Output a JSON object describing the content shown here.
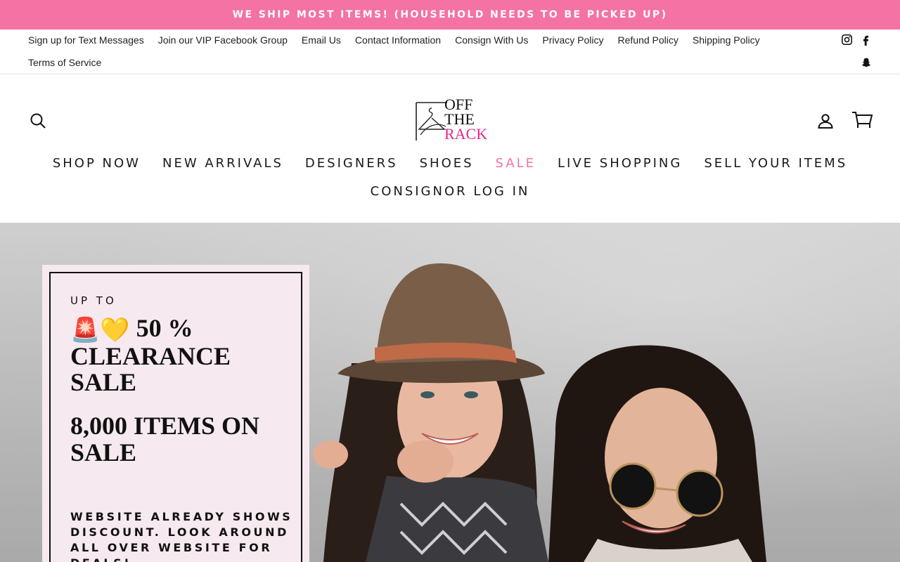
{
  "announcement": {
    "text": "WE SHIP MOST ITEMS! (HOUSEHOLD NEEDS TO BE PICKED UP)"
  },
  "utility_links": {
    "row1": [
      "Sign up for Text Messages",
      "Join our VIP Facebook Group",
      "Email Us",
      "Contact Information",
      "Consign With Us",
      "Privacy Policy",
      "Refund Policy",
      "Shipping Policy"
    ],
    "row2": [
      "Terms of Service"
    ]
  },
  "socials": {
    "row1": [
      {
        "name": "Instagram",
        "icon": "instagram-icon"
      },
      {
        "name": "Facebook",
        "icon": "facebook-icon"
      }
    ],
    "row2": [
      {
        "name": "Snapchat",
        "icon": "snapchat-icon"
      }
    ]
  },
  "header": {
    "logo": {
      "line1": "OFF",
      "line2": "THE",
      "line3": "RACK",
      "accent_color": "#e0288a"
    },
    "search_icon": "search-icon",
    "account_icon": "user-icon",
    "cart_icon": "cart-icon"
  },
  "nav": {
    "items": [
      "SHOP NOW",
      "NEW ARRIVALS",
      "DESIGNERS",
      "SHOES",
      "SALE",
      "LIVE SHOPPING",
      "SELL YOUR ITEMS"
    ],
    "row2": [
      "CONSIGNOR LOG IN"
    ],
    "sale_color": "#f272a6"
  },
  "hero": {
    "kicker": "UP TO",
    "emojis": "🚨💛",
    "headline1": "50 % CLEARANCE SALE",
    "headline2": "8,000 ITEMS ON SALE",
    "body": "WEBSITE ALREADY SHOWS DISCOUNT. LOOK AROUND ALL OVER WEBSITE FOR DEALS!",
    "panel_color": "#f6e9ef"
  },
  "colors": {
    "announcement_bg": "#f472a4",
    "brand_pink": "#e0288a"
  }
}
